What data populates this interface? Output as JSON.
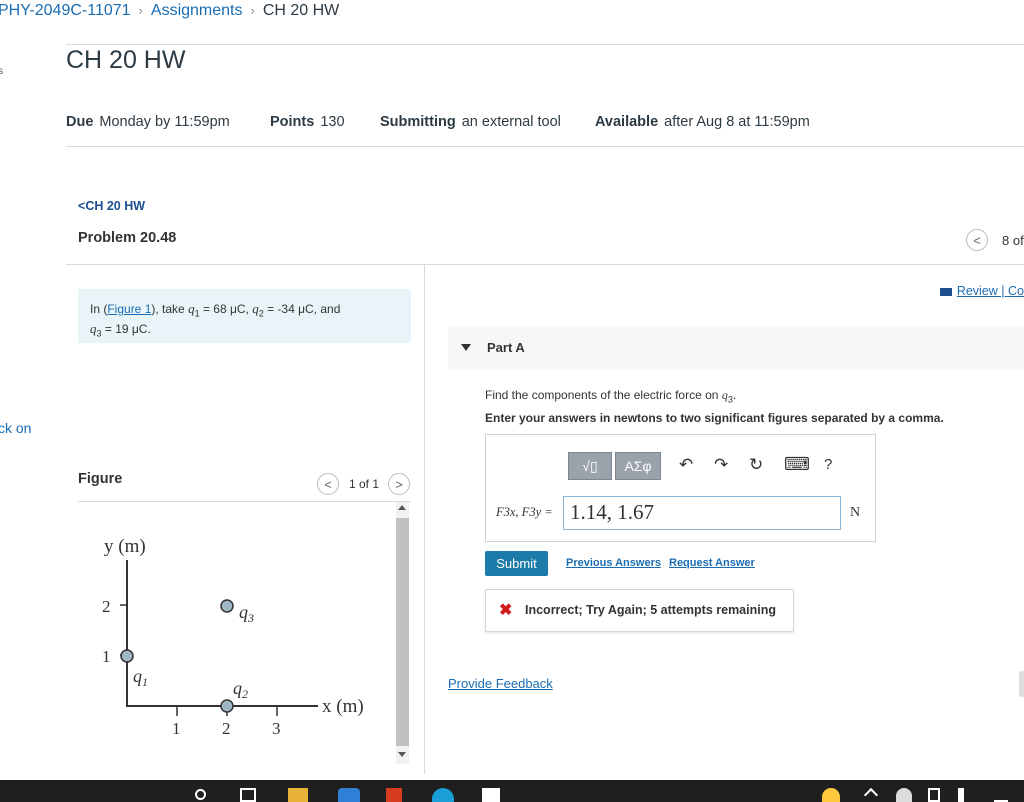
{
  "breadcrumb": {
    "course": "PHY-2049C-11071",
    "section": "Assignments",
    "current": "CH 20 HW",
    "separator": "›"
  },
  "page": {
    "title": "CH 20 HW"
  },
  "meta": {
    "due_label": "Due",
    "due_value": "Monday by 11:59pm",
    "points_label": "Points",
    "points_value": "130",
    "submitting_label": "Submitting",
    "submitting_value": "an external tool",
    "available_label": "Available",
    "available_value": "after Aug 8 at 11:59pm"
  },
  "left_cut": {
    "top": "s",
    "middle": "ck on"
  },
  "problem": {
    "back_label": "CH 20 HW",
    "back_chevron": "<",
    "title": "Problem 20.48",
    "nav_prev": "<",
    "nav_count": "8 of",
    "review_label": "Review | Co",
    "intro_pre": "In (",
    "intro_link": "Figure 1",
    "intro_post": "), take",
    "q1_sym": "q",
    "q1_sub": "1",
    "q1_val": "= 68 μC,",
    "q2_sym": "q",
    "q2_sub": "2",
    "q2_val": "= -34 μC, and",
    "q3_sym": "q",
    "q3_sub": "3",
    "q3_val": "= 19 μC."
  },
  "figure": {
    "label": "Figure",
    "page_prev": "<",
    "page_next": ">",
    "page_of": "1 of 1",
    "y_axis_label": "y (m)",
    "x_axis_label": "x (m)",
    "y_ticks": [
      "2",
      "1"
    ],
    "x_ticks": [
      "1",
      "2",
      "3"
    ],
    "charges": [
      {
        "name": "q",
        "sub": "1",
        "x": 0,
        "y": 1
      },
      {
        "name": "q",
        "sub": "2",
        "x": 2,
        "y": 0
      },
      {
        "name": "q",
        "sub": "3",
        "x": 2,
        "y": 2
      }
    ]
  },
  "part_a": {
    "label": "Part A",
    "question_pre": "Find the components of the electric force on",
    "question_sym": "q",
    "question_sub": "3",
    "instruction": "Enter your answers in newtons to two significant figures separated by a comma.",
    "toolbar": {
      "templates": "√▯",
      "symbols": "ΑΣφ",
      "undo": "↶",
      "redo": "↷",
      "reset": "↻",
      "keyboard": "⌨",
      "help": "?"
    },
    "answer_label": "F3x, F3y =",
    "answer_value": "1.14, 1.67",
    "unit": "N",
    "submit_label": "Submit",
    "previous_answers": "Previous Answers",
    "request_answer": "Request Answer",
    "feedback_icon": "✖",
    "feedback_text": "Incorrect; Try Again; 5 attempts remaining",
    "provide_feedback": "Provide Feedback"
  },
  "colors": {
    "link": "#1a6db3",
    "submit_bg": "#1b7ba8",
    "error": "#d21c1c",
    "info_bg": "#e8f4f8"
  }
}
